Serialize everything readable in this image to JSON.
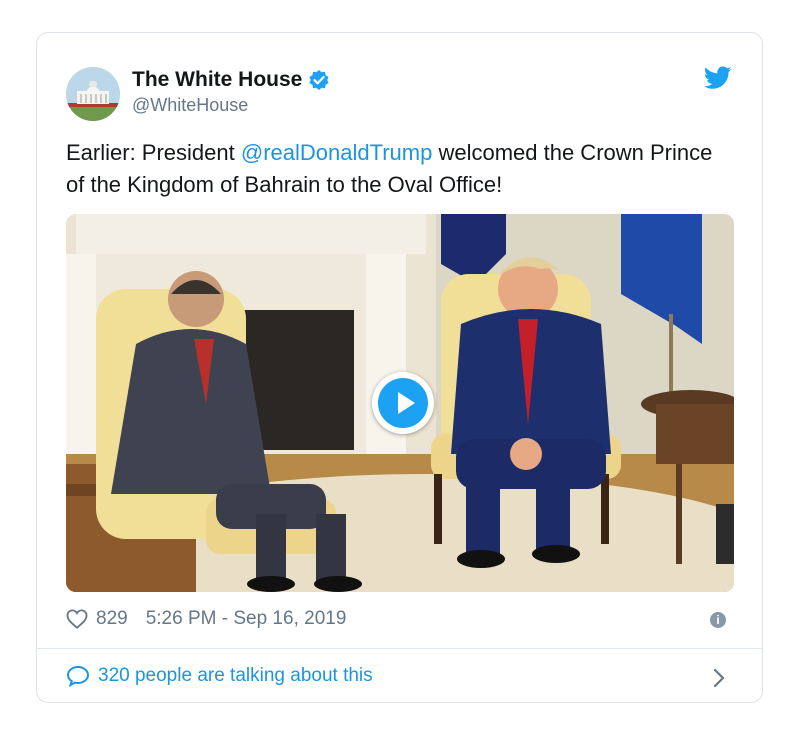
{
  "tweet": {
    "author": {
      "display_name": "The White House",
      "handle": "@WhiteHouse",
      "verified": true,
      "avatar_icon": "white-house-avatar"
    },
    "text": {
      "prefix": "Earlier: President ",
      "mention": "@realDonaldTrump",
      "suffix": " welcomed the Crown Prince of the Kingdom of Bahrain to the Oval Office!"
    },
    "media": {
      "type": "video",
      "play_icon": "play-icon"
    },
    "likes": "829",
    "timestamp": "5:26 PM - Sep 16, 2019",
    "talking": "320 people are talking about this"
  },
  "colors": {
    "accent": "#1da1f2",
    "link": "#1b95e0",
    "muted": "#657786",
    "border": "#dde3e8"
  },
  "icons": [
    "twitter-bird-icon",
    "verified-badge-icon",
    "heart-icon",
    "info-icon",
    "comment-bubble-icon",
    "chevron-right-icon"
  ]
}
